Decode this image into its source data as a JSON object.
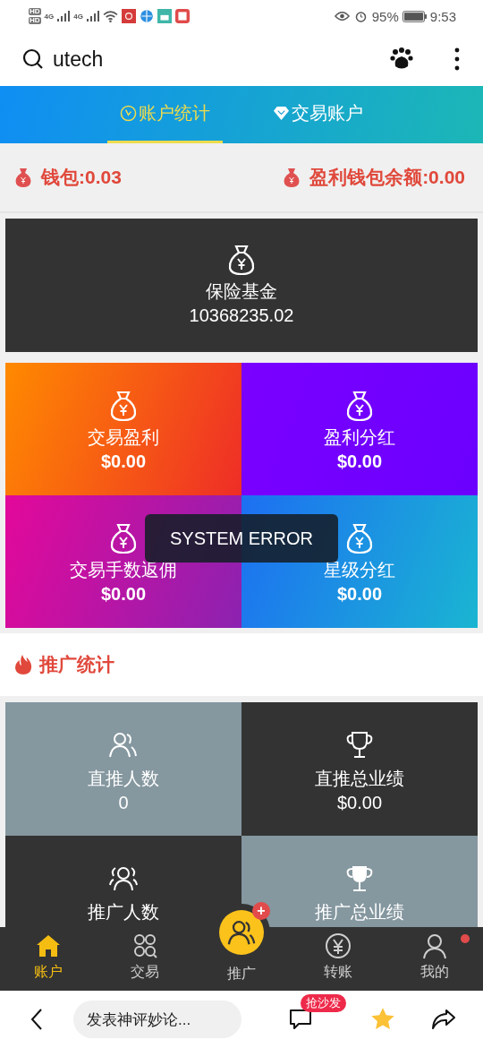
{
  "status_bar": {
    "hd_labels": [
      "HD",
      "HD"
    ],
    "network_labels": [
      "4G",
      "4G"
    ],
    "battery_percent": "95%",
    "time": "9:53"
  },
  "browser_bar": {
    "query": "utech"
  },
  "tabs": [
    {
      "label": "账户统计",
      "selected": true
    },
    {
      "label": "交易账户",
      "selected": false
    }
  ],
  "wallets": [
    "钱包:0.03",
    "盈利钱包余额:0.00"
  ],
  "insurance": {
    "label": "保险基金",
    "value": "10368235.02"
  },
  "earnings": [
    {
      "label": "交易盈利",
      "value": "$0.00"
    },
    {
      "label": "盈利分红",
      "value": "$0.00"
    },
    {
      "label": "交易手数返佣",
      "value": "$0.00"
    },
    {
      "label": "星级分红",
      "value": "$0.00"
    }
  ],
  "toast": "SYSTEM ERROR",
  "promo_section": {
    "title": "推广统计"
  },
  "promo_stats": [
    {
      "kind": "people",
      "label": "直推人数",
      "value": "0"
    },
    {
      "kind": "trophy",
      "label": "直推总业绩",
      "value": "$0.00"
    },
    {
      "kind": "group",
      "label": "推广人数"
    },
    {
      "kind": "cup",
      "label": "推广总业绩"
    }
  ],
  "nav": [
    {
      "kind": "home",
      "label": "账户",
      "selected": true,
      "dot": false
    },
    {
      "kind": "trade",
      "label": "交易",
      "selected": false,
      "dot": false
    },
    {
      "kind": "center",
      "label": "推广",
      "selected": false,
      "dot": false,
      "badge": "+"
    },
    {
      "kind": "yen",
      "label": "转账",
      "selected": false,
      "dot": false
    },
    {
      "kind": "user",
      "label": "我的",
      "selected": false,
      "dot": true
    }
  ],
  "bottom_bar": {
    "comment_placeholder": "发表神评妙论...",
    "comment_badge": "抢沙发"
  }
}
